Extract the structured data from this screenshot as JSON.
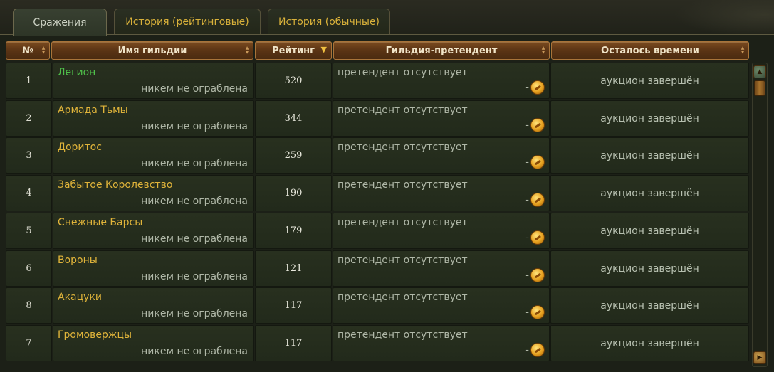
{
  "tabs": [
    {
      "label": "Сражения",
      "active": true
    },
    {
      "label": "История (рейтинговые)",
      "active": false
    },
    {
      "label": "История (обычные)",
      "active": false
    }
  ],
  "columns": {
    "num": "№",
    "name": "Имя гильдии",
    "rating": "Рейтинг",
    "pretender": "Гильдия-претендент",
    "time": "Осталось времени"
  },
  "rows": [
    {
      "num": "1",
      "name": "Легион",
      "robbed": "никем не ограблена",
      "rating": "520",
      "pretender": "претендент отсутствует",
      "dash": "-",
      "time": "аукцион завершён"
    },
    {
      "num": "2",
      "name": "Армада Тьмы",
      "robbed": "никем не ограблена",
      "rating": "344",
      "pretender": "претендент отсутствует",
      "dash": "-",
      "time": "аукцион завершён"
    },
    {
      "num": "3",
      "name": "Доритос",
      "robbed": "никем не ограблена",
      "rating": "259",
      "pretender": "претендент отсутствует",
      "dash": "-",
      "time": "аукцион завершён"
    },
    {
      "num": "4",
      "name": "Забытое Королевство",
      "robbed": "никем не ограблена",
      "rating": "190",
      "pretender": "претендент отсутствует",
      "dash": "-",
      "time": "аукцион завершён"
    },
    {
      "num": "5",
      "name": "Снежные Барсы",
      "robbed": "никем не ограблена",
      "rating": "179",
      "pretender": "претендент отсутствует",
      "dash": "-",
      "time": "аукцион завершён"
    },
    {
      "num": "6",
      "name": "Вороны",
      "robbed": "никем не ограблена",
      "rating": "121",
      "pretender": "претендент отсутствует",
      "dash": "-",
      "time": "аукцион завершён"
    },
    {
      "num": "8",
      "name": "Акацуки",
      "robbed": "никем не ограблена",
      "rating": "117",
      "pretender": "претендент отсутствует",
      "dash": "-",
      "time": "аукцион завершён"
    },
    {
      "num": "7",
      "name": "Громовержцы",
      "robbed": "никем не ограблена",
      "rating": "117",
      "pretender": "претендент отсутствует",
      "dash": "-",
      "time": "аукцион завершён"
    }
  ],
  "icons": {
    "coin": "gold-coin-icon",
    "sort": "sort-arrows-icon",
    "sort_active": "sort-desc-icon",
    "scroll_up": "scroll-up-icon",
    "scroll_down": "scroll-down-icon"
  },
  "colors": {
    "accent_gold": "#e0b43a",
    "highlight_green": "#4fc04a",
    "header_brown": "#5a3415"
  }
}
